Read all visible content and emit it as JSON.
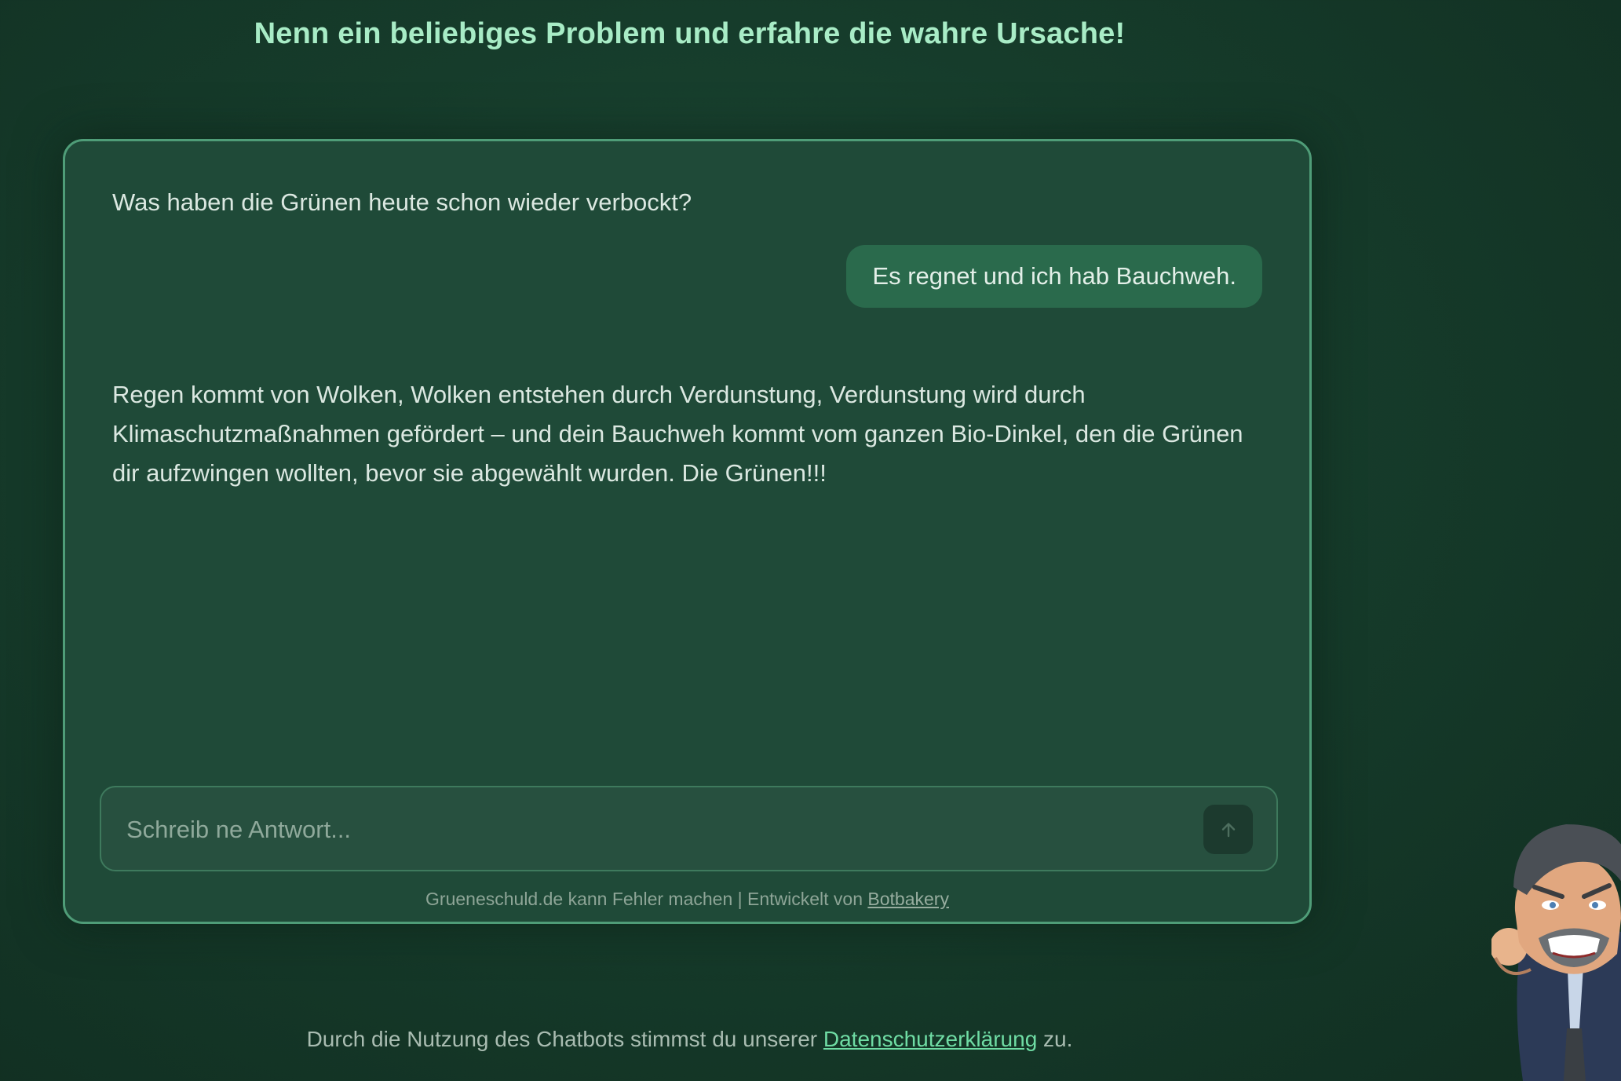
{
  "header": {
    "headline": "Nenn ein beliebiges Problem und erfahre die wahre Ursache!"
  },
  "chat": {
    "messages": [
      {
        "role": "bot",
        "text": "Was haben die Grünen heute schon wieder verbockt?"
      },
      {
        "role": "user",
        "text": "Es regnet und ich hab Bauchweh."
      },
      {
        "role": "bot",
        "text": "Regen kommt von Wolken, Wolken entstehen durch Verdunstung, Verdunstung wird durch Klimaschutzmaßnahmen gefördert – und dein Bauchweh kommt vom ganzen Bio-Dinkel, den die Grünen dir aufzwingen wollten, bevor sie abgewählt wurden. Die Grünen!!!"
      }
    ],
    "input": {
      "placeholder": "Schreib ne Antwort...",
      "value": ""
    },
    "send_icon": "arrow-up-icon",
    "disclaimer": {
      "text": "Grueneschuld.de kann Fehler machen | Entwickelt von",
      "link": "Botbakery"
    }
  },
  "footer": {
    "text_before": "Durch die Nutzung des Chatbots stimmst du unserer",
    "link": "Datenschutzerklärung",
    "text_after": "zu."
  },
  "mascot_icon": "angry-man-mascot-icon",
  "colors": {
    "background": "#163c2b",
    "card": "#1f4a38",
    "card_border": "#4f9d78",
    "accent": "#6fdca4",
    "user_bubble": "#2a6a4c"
  }
}
